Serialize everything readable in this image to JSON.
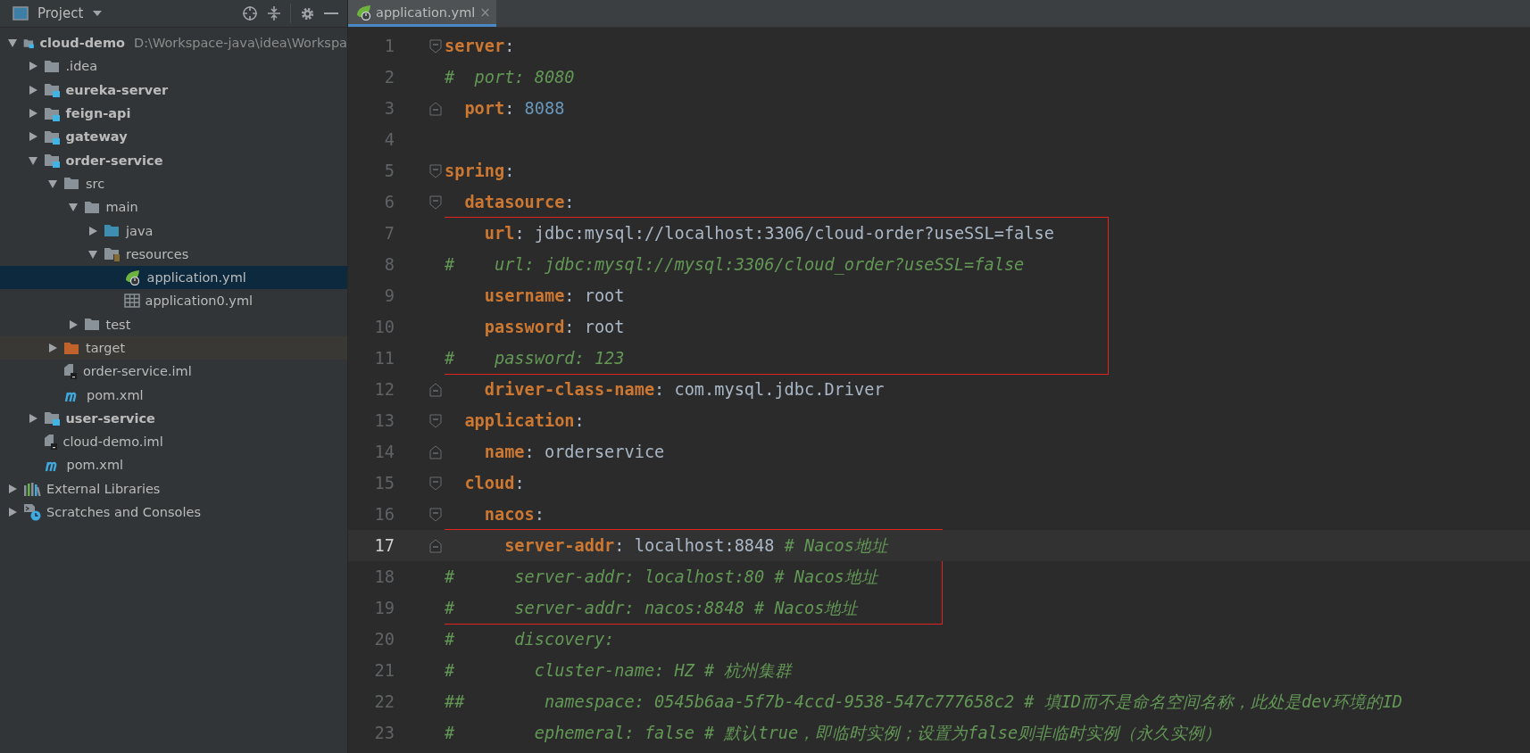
{
  "project_panel": {
    "title": "Project",
    "tree": [
      {
        "label": "cloud-demo",
        "hint": "D:\\Workspace-java\\idea\\Workspa",
        "kind": "module",
        "expanded": true,
        "selected": false,
        "children": [
          {
            "label": ".idea",
            "kind": "folder",
            "expanded": false,
            "selected": false
          },
          {
            "label": "eureka-server",
            "kind": "module",
            "expanded": false,
            "selected": false
          },
          {
            "label": "feign-api",
            "kind": "module",
            "expanded": false,
            "selected": false
          },
          {
            "label": "gateway",
            "kind": "module",
            "expanded": false,
            "selected": false
          },
          {
            "label": "order-service",
            "kind": "module",
            "expanded": true,
            "selected": false,
            "children": [
              {
                "label": "src",
                "kind": "folder",
                "expanded": true,
                "selected": false,
                "children": [
                  {
                    "label": "main",
                    "kind": "folder",
                    "expanded": true,
                    "selected": false,
                    "children": [
                      {
                        "label": "java",
                        "kind": "source",
                        "expanded": false,
                        "selected": false
                      },
                      {
                        "label": "resources",
                        "kind": "resources",
                        "expanded": true,
                        "selected": false,
                        "children": [
                          {
                            "label": "application.yml",
                            "kind": "spring",
                            "selected": true
                          },
                          {
                            "label": "application0.yml",
                            "kind": "table",
                            "selected": false
                          }
                        ]
                      }
                    ]
                  },
                  {
                    "label": "test",
                    "kind": "folder",
                    "expanded": false,
                    "selected": false
                  }
                ]
              },
              {
                "label": "target",
                "kind": "excluded",
                "expanded": false,
                "selected": false
              },
              {
                "label": "order-service.iml",
                "kind": "iml",
                "selected": false
              },
              {
                "label": "pom.xml",
                "kind": "maven",
                "selected": false
              }
            ]
          },
          {
            "label": "user-service",
            "kind": "module",
            "expanded": false,
            "selected": false
          },
          {
            "label": "cloud-demo.iml",
            "kind": "iml",
            "selected": false
          },
          {
            "label": "pom.xml",
            "kind": "maven",
            "selected": false
          }
        ]
      },
      {
        "label": "External Libraries",
        "kind": "libraries",
        "expanded": false,
        "selected": false
      },
      {
        "label": "Scratches and Consoles",
        "kind": "scratches",
        "expanded": false,
        "selected": false
      }
    ]
  },
  "tabs": [
    {
      "label": "application.yml",
      "close": "×",
      "selected": true
    }
  ],
  "editor": {
    "blocks": [
      {
        "boxed": false,
        "lines": [
          {
            "number": "1",
            "fold_start": true,
            "current": false,
            "tokens": [
              {
                "kind": "key",
                "text": "server"
              },
              {
                "kind": "punct",
                "text": ":"
              }
            ]
          },
          {
            "number": "2",
            "current": false,
            "tokens": [
              {
                "kind": "comment",
                "text": "#  port: 8080"
              }
            ]
          },
          {
            "number": "3",
            "fold_end": true,
            "current": false,
            "tokens": [
              {
                "kind": "key",
                "text": "  port"
              },
              {
                "kind": "punct",
                "text": ": "
              },
              {
                "kind": "number",
                "text": "8088"
              }
            ]
          },
          {
            "number": "4",
            "current": false
          },
          {
            "number": "5",
            "fold_start": true,
            "current": false,
            "tokens": [
              {
                "kind": "key",
                "text": "spring"
              },
              {
                "kind": "punct",
                "text": ":"
              }
            ]
          },
          {
            "number": "6",
            "fold_start": true,
            "current": false,
            "tokens": [
              {
                "kind": "key",
                "text": "  datasource"
              },
              {
                "kind": "punct",
                "text": ":"
              }
            ]
          }
        ]
      },
      {
        "boxed": true,
        "lines": [
          {
            "number": "7",
            "current": false,
            "tokens": [
              {
                "kind": "key",
                "text": "    url"
              },
              {
                "kind": "punct",
                "text": ": "
              },
              {
                "kind": "value",
                "text": "jdbc:mysql://localhost:3306/cloud-order?useSSL=false"
              }
            ]
          },
          {
            "number": "8",
            "current": false,
            "tokens": [
              {
                "kind": "comment",
                "text": "#    url: jdbc:mysql://mysql:3306/cloud_order?useSSL=false"
              }
            ]
          },
          {
            "number": "9",
            "current": false,
            "tokens": [
              {
                "kind": "key",
                "text": "    username"
              },
              {
                "kind": "punct",
                "text": ": "
              },
              {
                "kind": "value",
                "text": "root"
              }
            ]
          },
          {
            "number": "10",
            "current": false,
            "tokens": [
              {
                "kind": "key",
                "text": "    password"
              },
              {
                "kind": "punct",
                "text": ": "
              },
              {
                "kind": "value",
                "text": "root"
              }
            ]
          },
          {
            "number": "11",
            "current": false,
            "tokens": [
              {
                "kind": "comment",
                "text": "#    password: 123"
              }
            ]
          }
        ]
      },
      {
        "boxed": false,
        "lines": [
          {
            "number": "12",
            "fold_end": true,
            "current": false,
            "tokens": [
              {
                "kind": "key",
                "text": "    driver-class-name"
              },
              {
                "kind": "punct",
                "text": ": "
              },
              {
                "kind": "value",
                "text": "com.mysql.jdbc.Driver"
              }
            ]
          },
          {
            "number": "13",
            "fold_start": true,
            "current": false,
            "tokens": [
              {
                "kind": "key",
                "text": "  application"
              },
              {
                "kind": "punct",
                "text": ":"
              }
            ]
          },
          {
            "number": "14",
            "fold_end": true,
            "current": false,
            "tokens": [
              {
                "kind": "key",
                "text": "    name"
              },
              {
                "kind": "punct",
                "text": ": "
              },
              {
                "kind": "value",
                "text": "orderservice"
              }
            ]
          },
          {
            "number": "15",
            "fold_start": true,
            "current": false,
            "tokens": [
              {
                "kind": "key",
                "text": "  cloud"
              },
              {
                "kind": "punct",
                "text": ":"
              }
            ]
          },
          {
            "number": "16",
            "fold_start": true,
            "current": false,
            "tokens": [
              {
                "kind": "key",
                "text": "    nacos"
              },
              {
                "kind": "punct",
                "text": ":"
              }
            ]
          }
        ]
      },
      {
        "boxed": true,
        "lines": [
          {
            "number": "17",
            "fold_end": true,
            "current": true,
            "tokens": [
              {
                "kind": "key",
                "text": "      server-addr"
              },
              {
                "kind": "punct",
                "text": ": "
              },
              {
                "kind": "value",
                "text": "localhost:8848 "
              },
              {
                "kind": "comment",
                "text": "# Nacos地址"
              }
            ]
          },
          {
            "number": "18",
            "current": false,
            "tokens": [
              {
                "kind": "comment",
                "text": "#      server-addr: localhost:80 # Nacos地址"
              }
            ]
          },
          {
            "number": "19",
            "current": false,
            "tokens": [
              {
                "kind": "comment",
                "text": "#      server-addr: nacos:8848 # Nacos地址"
              }
            ]
          }
        ]
      },
      {
        "boxed": false,
        "lines": [
          {
            "number": "20",
            "current": false,
            "tokens": [
              {
                "kind": "comment",
                "text": "#      discovery:"
              }
            ]
          },
          {
            "number": "21",
            "current": false,
            "tokens": [
              {
                "kind": "comment",
                "text": "#        cluster-name: HZ # 杭州集群"
              }
            ]
          },
          {
            "number": "22",
            "current": false,
            "tokens": [
              {
                "kind": "comment",
                "text": "##        namespace: 0545b6aa-5f7b-4ccd-9538-547c777658c2 # 填ID而不是命名空间名称，此处是dev环境的ID"
              }
            ]
          },
          {
            "number": "23",
            "current": false,
            "tokens": [
              {
                "kind": "comment",
                "text": "#        ephemeral: false # 默认true，即临时实例；设置为false则非临时实例（永久实例）"
              }
            ]
          }
        ]
      }
    ]
  }
}
